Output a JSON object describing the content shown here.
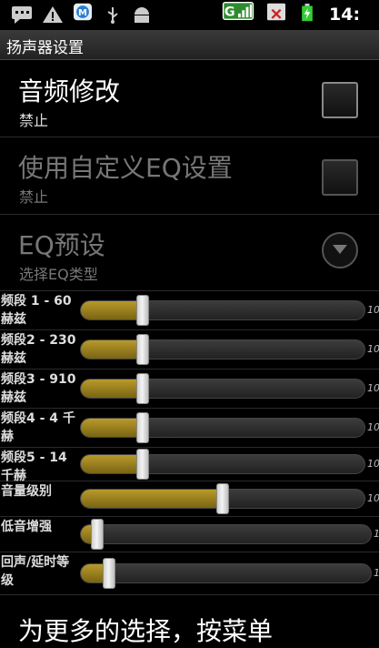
{
  "status_bar": {
    "time": "14:",
    "icons": [
      "chat-icon",
      "warning-icon",
      "maxthon-icon",
      "usb-icon",
      "android-debug-icon",
      "signal-g-icon",
      "no-sim-icon",
      "battery-charging-icon"
    ]
  },
  "title_bar": {
    "title": "扬声器设置"
  },
  "prefs": [
    {
      "title": "音频修改",
      "summary": "禁止",
      "enabled": true,
      "checked": false
    },
    {
      "title": "使用自定义EQ设置",
      "summary": "禁止",
      "enabled": false,
      "checked": false
    },
    {
      "title": "EQ预设",
      "summary": "选择EQ类型",
      "enabled": false
    }
  ],
  "sliders": [
    {
      "label": "频段 1 - 60 赫兹",
      "value": 0.22,
      "max_label": "10"
    },
    {
      "label": "频段2 - 230 赫兹",
      "value": 0.22,
      "max_label": "10"
    },
    {
      "label": "频段3 - 910 赫兹",
      "value": 0.22,
      "max_label": "10"
    },
    {
      "label": "频段4 - 4 千赫",
      "value": 0.22,
      "max_label": "10"
    },
    {
      "label": "频段5 - 14 千赫",
      "value": 0.22,
      "max_label": "10"
    },
    {
      "label": "音量级别",
      "value": 0.5,
      "max_label": "10"
    },
    {
      "label": "低音增强",
      "value": 0.06,
      "max_label": "1"
    },
    {
      "label": "回声/延时等级",
      "value": 0.1,
      "max_label": "1"
    }
  ],
  "footer_text": "为更多的选择，按菜单"
}
